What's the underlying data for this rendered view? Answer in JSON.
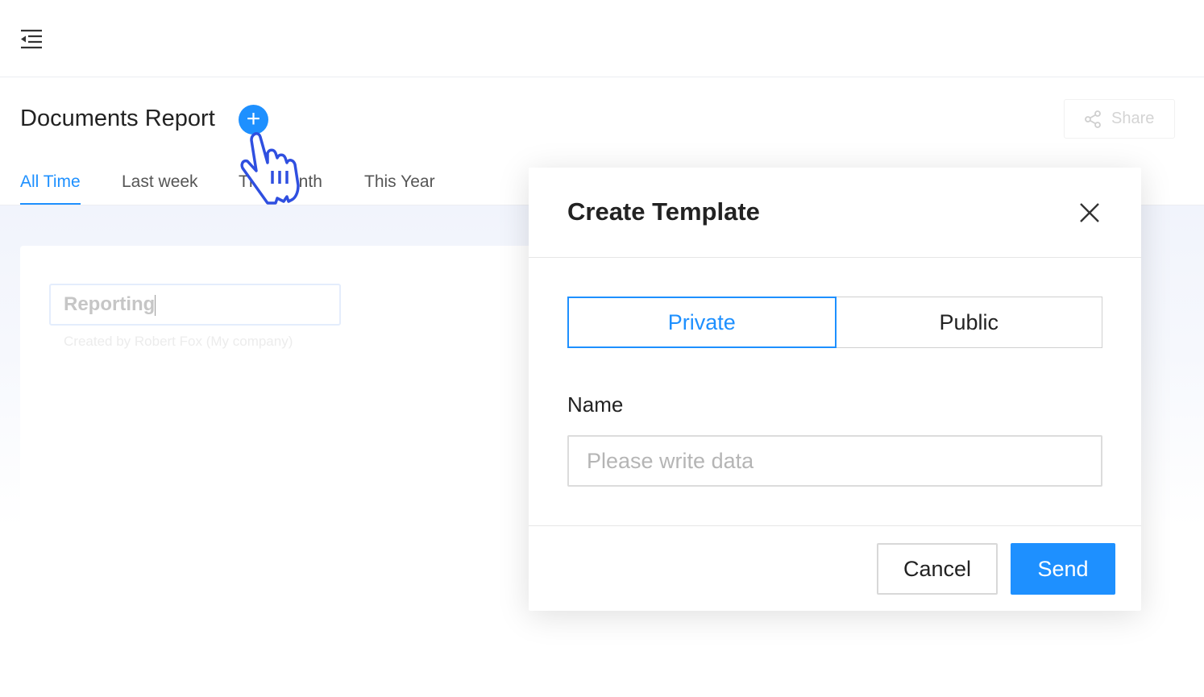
{
  "header": {
    "menu_icon": "menu-collapse-icon"
  },
  "page": {
    "title": "Documents Report",
    "add_label": "+",
    "share_label": "Share"
  },
  "tabs": [
    {
      "label": "All Time",
      "active": true
    },
    {
      "label": "Last week"
    },
    {
      "label": "This Month"
    },
    {
      "label": "This Year"
    }
  ],
  "card": {
    "input_value": "Reporting",
    "created": "Created by Robert Fox (My company)"
  },
  "modal": {
    "title": "Create Template",
    "segments": [
      {
        "label": "Private",
        "active": true
      },
      {
        "label": "Public"
      }
    ],
    "name_label": "Name",
    "name_placeholder": "Please write data",
    "cancel_label": "Cancel",
    "send_label": "Send"
  },
  "colors": {
    "accent": "#1e90ff",
    "cursor": "#2f4fe0"
  }
}
